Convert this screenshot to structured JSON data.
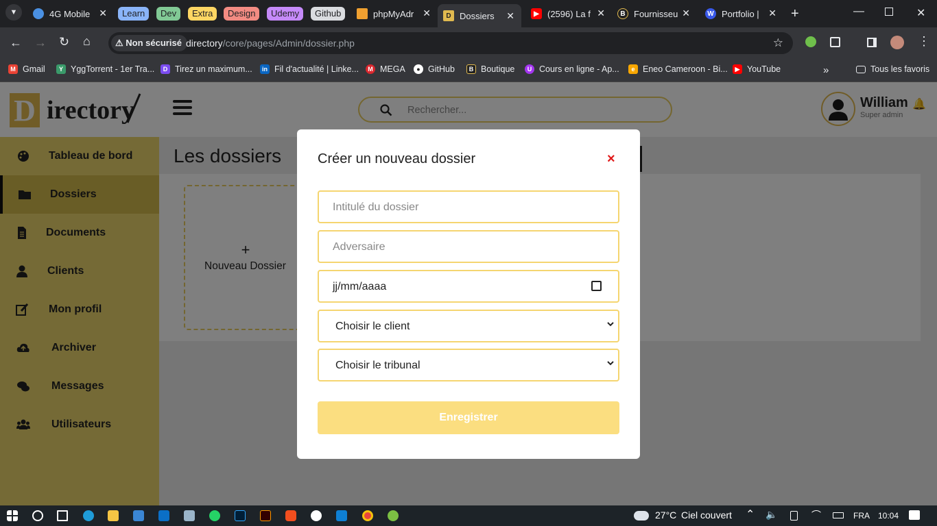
{
  "browser": {
    "tabs": [
      {
        "label": "4G Mobile"
      },
      {
        "label": "phpMyAdr"
      },
      {
        "label": "Dossiers"
      },
      {
        "label": "(2596) La f"
      },
      {
        "label": "Fournisseu"
      },
      {
        "label": "Portfolio |"
      }
    ],
    "tab_groups": [
      "Learn",
      "Dev",
      "Extra",
      "Design",
      "Udemy",
      "Github"
    ],
    "security_label": "Non sécurisé",
    "url_domain": "directory",
    "url_path": "/core/pages/Admin/dossier.php",
    "bookmarks": [
      "Gmail",
      "YggTorrent - 1er Tra...",
      "Tirez un maximum...",
      "Fil d'actualité | Linke...",
      "MEGA",
      "GitHub",
      "Boutique",
      "Cours en ligne - Ap...",
      "Eneo Cameroon - Bi...",
      "YouTube"
    ],
    "all_bookmarks": "Tous les favoris"
  },
  "app": {
    "logo_letter": "D",
    "logo_text": "irectory",
    "search_placeholder": "Rechercher...",
    "user_name": "William",
    "user_role": "Super admin",
    "sidebar": [
      {
        "label": "Tableau de bord",
        "icon": "palette-icon"
      },
      {
        "label": "Dossiers",
        "icon": "folder-icon"
      },
      {
        "label": "Documents",
        "icon": "file-icon"
      },
      {
        "label": "Clients",
        "icon": "user-icon"
      },
      {
        "label": "Mon profil",
        "icon": "edit-icon"
      },
      {
        "label": "Archiver",
        "icon": "cloud-upload-icon"
      },
      {
        "label": "Messages",
        "icon": "comments-icon"
      },
      {
        "label": "Utilisateurs",
        "icon": "users-icon"
      }
    ],
    "page_title": "Les dossiers",
    "new_card_plus": "+",
    "new_card_label": "Nouveau Dossier"
  },
  "modal": {
    "title": "Créer un nouveau dossier",
    "close": "×",
    "title_placeholder": "Intitulé du dossier",
    "adversary_placeholder": "Adversaire",
    "date_placeholder": "jj/mm/aaaa",
    "client_select": "Choisir le client",
    "court_select": "Choisir le tribunal",
    "save": "Enregistrer"
  },
  "taskbar": {
    "temperature": "27°C",
    "weather": "Ciel couvert",
    "language": "FRA",
    "time": "10:04"
  }
}
